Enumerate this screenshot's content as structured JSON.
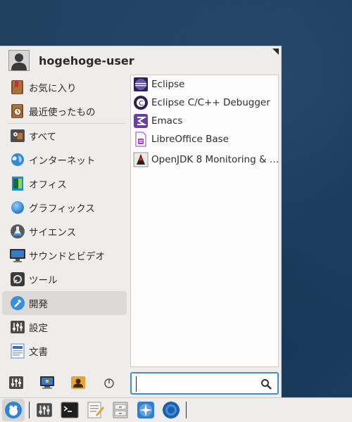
{
  "user": {
    "name": "hogehoge-user"
  },
  "categories": [
    {
      "label": "お気に入り",
      "icon": "bookmark-icon",
      "active": false
    },
    {
      "label": "最近使ったもの",
      "icon": "recent-clock-icon",
      "active": false
    },
    {
      "label": "すべて",
      "icon": "all-apps-icon",
      "active": false
    },
    {
      "label": "インターネット",
      "icon": "internet-globe-icon",
      "active": false
    },
    {
      "label": "オフィス",
      "icon": "office-document-icon",
      "active": false
    },
    {
      "label": "グラフィックス",
      "icon": "graphics-sphere-icon",
      "active": false
    },
    {
      "label": "サイエンス",
      "icon": "science-flask-icon",
      "active": false
    },
    {
      "label": "サウンドとビデオ",
      "icon": "monitor-media-icon",
      "active": false
    },
    {
      "label": "ツール",
      "icon": "tools-icon",
      "active": false
    },
    {
      "label": "開発",
      "icon": "development-hammer-icon",
      "active": true
    },
    {
      "label": "設定",
      "icon": "settings-sliders-icon",
      "active": false
    },
    {
      "label": "文書",
      "icon": "documents-icon",
      "active": false
    }
  ],
  "apps": [
    {
      "label": "Eclipse",
      "icon": "eclipse-icon"
    },
    {
      "label": "Eclipse C/C++ Debugger",
      "icon": "eclipse-cdt-icon"
    },
    {
      "label": "Emacs",
      "icon": "emacs-icon"
    },
    {
      "label": "LibreOffice Base",
      "icon": "libreoffice-base-icon"
    },
    {
      "label": "OpenJDK 8 Monitoring & …",
      "icon": "openjdk-duke-icon"
    }
  ],
  "search": {
    "value": "",
    "placeholder": ""
  },
  "colors": {
    "accent": "#3d8fd6",
    "menu_bg": "#efedeb",
    "selected": "#dcdad7"
  }
}
